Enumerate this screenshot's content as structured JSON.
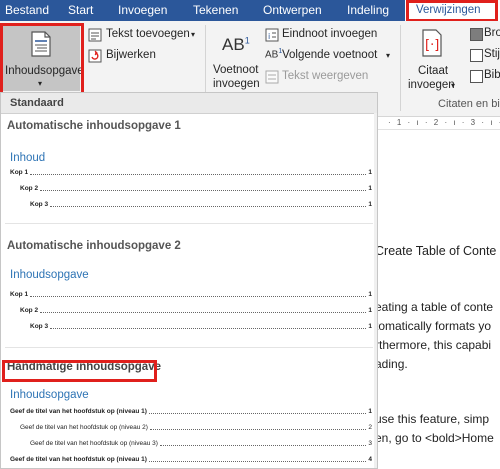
{
  "tabs": [
    "Bestand",
    "Start",
    "Invoegen",
    "Tekenen",
    "Ontwerpen",
    "Indeling",
    "Verwijzingen"
  ],
  "ribbon": {
    "toc_button_label": "Inhoudsopgave",
    "add_text_label": "Tekst toevoegen",
    "update_label": "Bijwerken",
    "footnote_icon_text": "AB",
    "footnote_icon_sup": "1",
    "insert_footnote_line1": "Voetnoot",
    "insert_footnote_line2": "invoegen",
    "insert_endnote_label": "Eindnoot invoegen",
    "next_footnote_label": "Volgende voetnoot",
    "show_notes_label": "Tekst weergeven",
    "insert_citation_line1": "Citaat",
    "insert_citation_line2": "invoegen",
    "citations_group_label": "Citaten en bi",
    "right_items": [
      "Bro",
      "Stij",
      "Bib"
    ]
  },
  "ruler_text": "· 1 · ı · 2 · ı · 3 · ı · 4",
  "document": {
    "lines": [
      "Create Table of Conte",
      "eating a table of conte",
      "tomatically formats yo",
      "rthermore, this capabi",
      "ading.",
      "use this feature, simp",
      "en, go to <bold>Home"
    ]
  },
  "gallery": {
    "header": "Standaard",
    "auto1": {
      "title": "Automatische inhoudsopgave 1",
      "heading": "Inhoud",
      "rows": [
        {
          "label": "Kop 1",
          "page": "1"
        },
        {
          "label": "Kop 2",
          "page": "1"
        },
        {
          "label": "Kop 3",
          "page": "1"
        }
      ]
    },
    "auto2": {
      "title": "Automatische inhoudsopgave 2",
      "heading": "Inhoudsopgave",
      "rows": [
        {
          "label": "Kop 1",
          "page": "1"
        },
        {
          "label": "Kop 2",
          "page": "1"
        },
        {
          "label": "Kop 3",
          "page": "1"
        }
      ]
    },
    "manual": {
      "title": "Handmatige inhoudsopgave",
      "heading": "Inhoudsopgave",
      "rows": [
        {
          "label": "Geef de titel van het hoofdstuk op (niveau 1)",
          "page": "1"
        },
        {
          "label": "Geef de titel van het hoofdstuk op (niveau 2)",
          "page": "2"
        },
        {
          "label": "Geef de titel van het hoofdstuk op (niveau 3)",
          "page": "3"
        },
        {
          "label": "Geef de titel van het hoofdstuk op (niveau 1)",
          "page": "4"
        }
      ]
    }
  },
  "colors": {
    "tab_bar": "#2b579a",
    "highlight": "#e0201c",
    "toc_heading": "#2e74b5"
  }
}
